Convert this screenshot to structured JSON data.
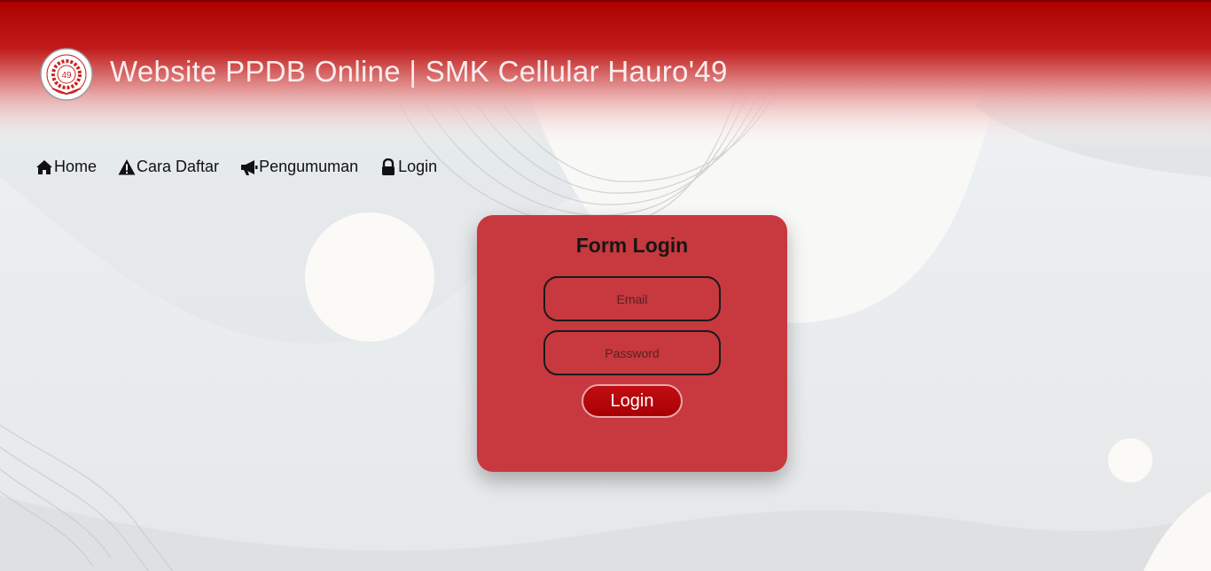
{
  "header": {
    "title": "Website PPDB Online | SMK Cellular Hauro'49",
    "logo_text": "49"
  },
  "nav": {
    "items": [
      {
        "label": "Home",
        "icon": "home-icon"
      },
      {
        "label": "Cara Daftar",
        "icon": "warning-icon"
      },
      {
        "label": "Pengumuman",
        "icon": "megaphone-icon"
      },
      {
        "label": "Login",
        "icon": "lock-icon"
      }
    ]
  },
  "form": {
    "title": "Form Login",
    "email_placeholder": "Email",
    "password_placeholder": "Password",
    "submit_label": "Login"
  },
  "colors": {
    "header_red": "#b10000",
    "card_red": "#c7393e",
    "button_red": "#b80008"
  }
}
